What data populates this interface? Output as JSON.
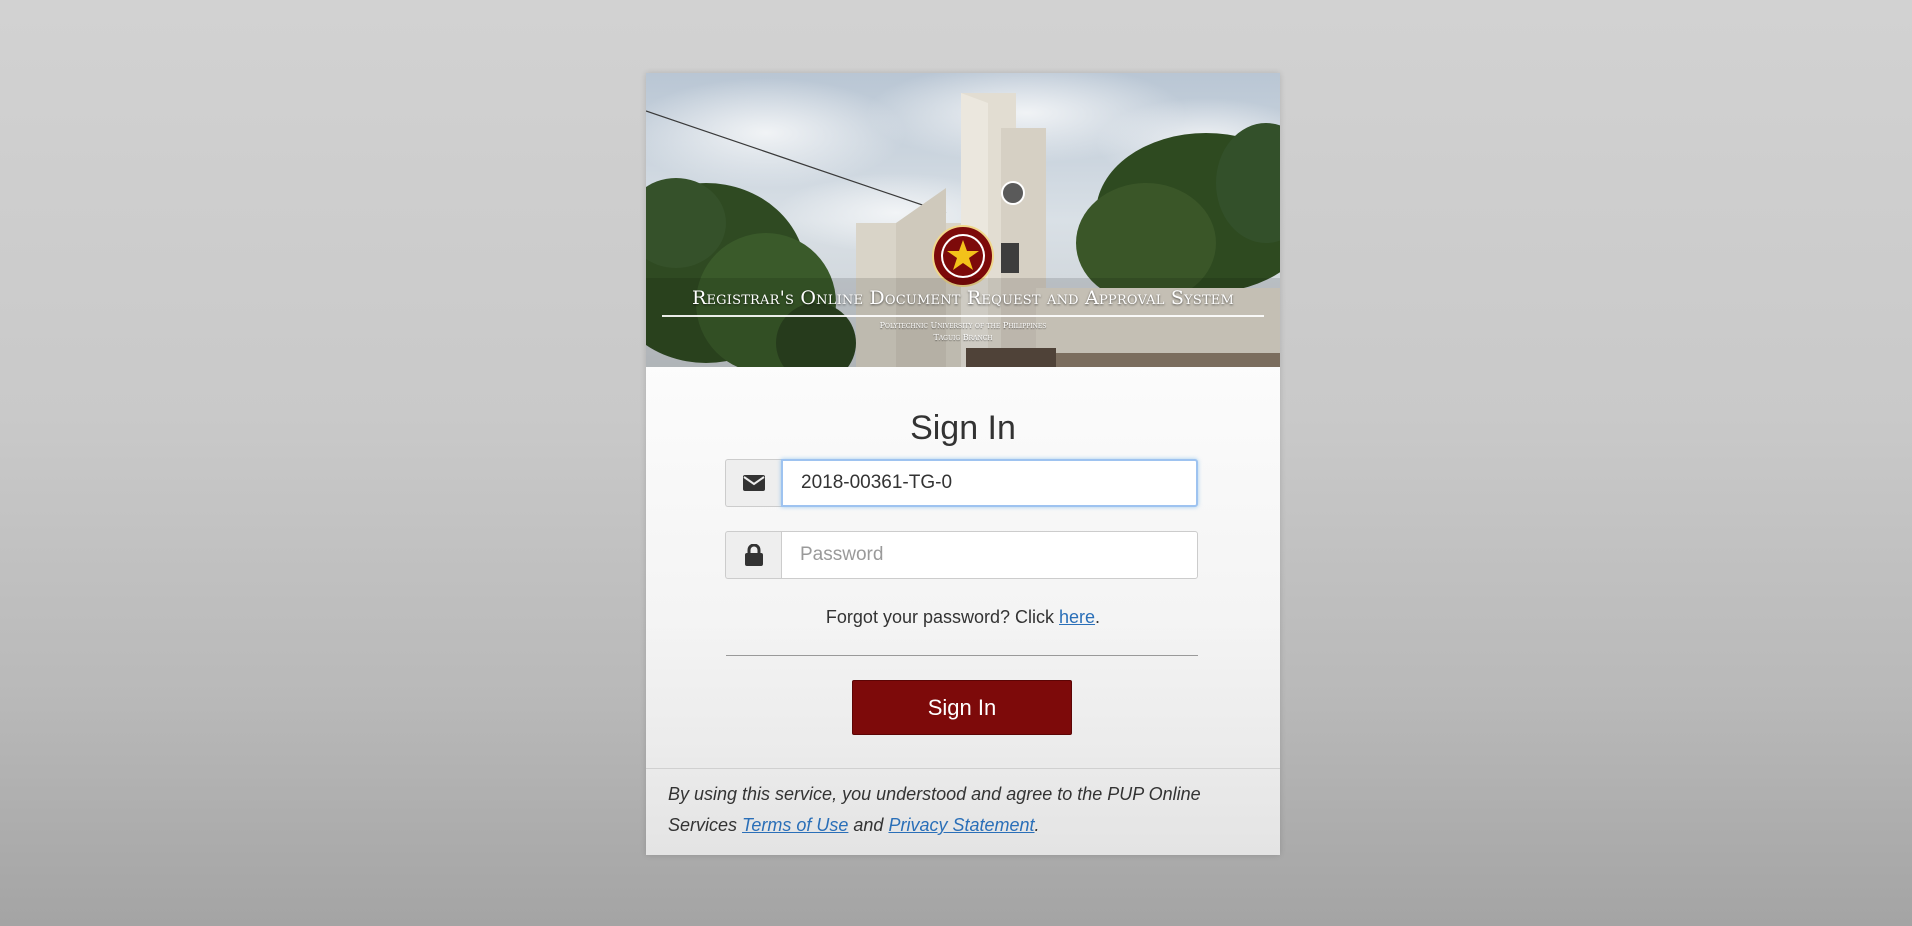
{
  "banner": {
    "title": "Registrar's Online Document Request and Approval System",
    "university": "Polytechnic University of the Philippines",
    "branch": "Taguig Branch"
  },
  "signin": {
    "title": "Sign In",
    "username_value": "2018-00361-TG-0",
    "password_placeholder": "Password",
    "forgot_text": "Forgot your password? Click ",
    "forgot_link": "here",
    "forgot_suffix": ".",
    "button_label": "Sign In"
  },
  "footer": {
    "text_before": "By using this service, you understood and agree to the PUP Online Services ",
    "terms_link": "Terms of Use",
    "and_text": " and ",
    "privacy_link": "Privacy Statement",
    "suffix": "."
  },
  "icons": {
    "username": "envelope-icon",
    "password": "lock-icon",
    "seal": "pup-seal-icon"
  },
  "colors": {
    "primary_button": "#7d0a0a",
    "link": "#2a6fb8",
    "focus_border": "#9ec3f0"
  }
}
